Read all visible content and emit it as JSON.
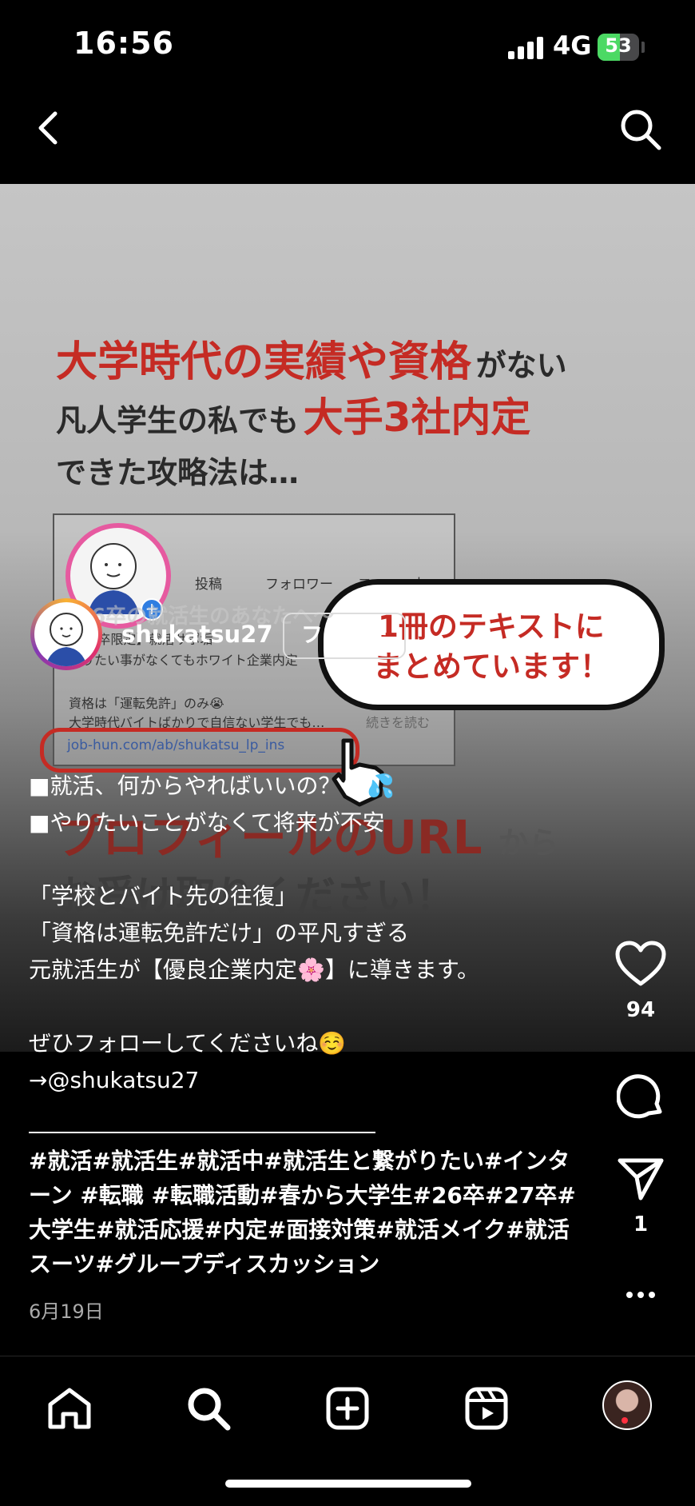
{
  "status": {
    "time": "16:56",
    "network": "4G",
    "battery": "53"
  },
  "post_image": {
    "headline_1a": "大学時代の実績や資格",
    "headline_1b": "がない",
    "headline_2a": "凡人学生の私でも",
    "headline_2b": "大手3社内定",
    "headline_3": "できた攻略法は…",
    "card_stat_posts": "投稿",
    "card_stat_followers": "フォロワー",
    "card_stat_following": "フォロー中",
    "card_bio_1": "【26卒限定】就活サポ垢",
    "card_bio_2": "やりたい事がなくてもホワイト企業内定",
    "card_bio_3": "資格は「運転免許」のみ😭",
    "card_bio_4": "大学時代バイトばかりで自信ない学生でも…",
    "card_read_more": "続きを読む",
    "card_link": "job-hun.com/ab/shukatsu_lp_ins",
    "bubble_line_1": "1冊のテキストに",
    "bubble_line_2": "まとめています！",
    "subtext_overlay": "〜26卒の就活生のあなたへ〜",
    "bottom_1a": "プロフィールのURL",
    "bottom_1b": "から",
    "bottom_2": "お受け取りください！"
  },
  "author": {
    "username": "shukatsu27",
    "follow_label": "フォロー"
  },
  "caption": {
    "lines": [
      "■就活、何からやればいいの？😭💦",
      "■やりたいことがなくて将来が不安",
      "",
      "「学校とバイト先の往復」",
      "「資格は運転免許だけ」の平凡すぎる",
      "元就活生が【優良企業内定🌸】に導きます。",
      "",
      "ぜひフォローしてくださいね☺️",
      "→@shukatsu27"
    ],
    "hashtags": " #就活#就活生#就活中#就活生と繋がりたい#インターン #転職 #転職活動#春から大学生#26卒#27卒#大学生#就活応援#内定#面接対策#就活メイク#就活スーツ#グループディスカッション"
  },
  "date": "6月19日",
  "actions": {
    "likes": "94",
    "shares": "1"
  }
}
